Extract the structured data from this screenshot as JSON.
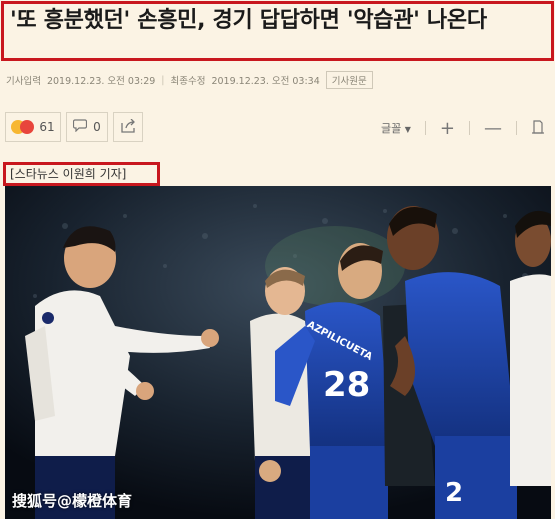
{
  "article": {
    "headline": "'또 흥분했던' 손흥민, 경기 답답하면 '악습관' 나온다",
    "meta": {
      "published_label": "기사입력",
      "published_value": "2019.12.23. 오전 03:29",
      "modified_label": "최종수정",
      "modified_value": "2019.12.23. 오전 03:34",
      "original_button": "기사원문"
    },
    "toolbar": {
      "reactions_count": "61",
      "comments_count": "0",
      "font_label": "글꼴"
    },
    "reporter": "[스타뉴스 이원희 기자]",
    "photo": {
      "watermark": "搜狐号@檬橙体育",
      "jersey_numbers": [
        "28",
        "2"
      ],
      "jersey_text": "AZPILICUETA"
    }
  },
  "colors": {
    "highlight_red": "#c8171e",
    "page_bg": "#fbf3e4",
    "chelsea_blue": "#1b3fa0",
    "spurs_white": "#f2f0ec"
  }
}
